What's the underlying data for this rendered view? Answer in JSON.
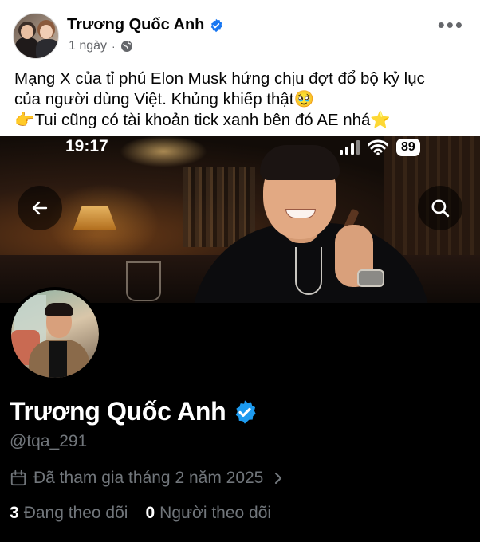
{
  "post": {
    "author": "Trương Quốc Anh",
    "time": "1 ngày",
    "separator": "·",
    "more": "•••",
    "text_lines": [
      "Mạng X của tỉ phú Elon Musk hứng chịu đợt đổ bộ kỷ lục",
      "của người dùng Việt. Khủng khiếp thật🥹",
      "👉Tui cũng có tài khoản tick xanh bên đó AE nhá⭐"
    ]
  },
  "screenshot": {
    "status": {
      "time": "19:17",
      "battery": "89"
    },
    "profile": {
      "name": "Trương Quốc Anh",
      "handle": "@tqa_291",
      "joined": "Đã tham gia tháng 2 năm 2025",
      "following_count": "3",
      "following_label": "Đang theo dõi",
      "followers_count": "0",
      "followers_label": "Người theo dõi"
    }
  },
  "colors": {
    "facebook_verified": "#1877f2",
    "x_verified": "#1d9bf0",
    "x_muted_text": "#71767b",
    "x_background": "#000000"
  },
  "icons": [
    "globe-icon",
    "more-icon",
    "verified-badge-icon",
    "back-arrow-icon",
    "search-icon",
    "calendar-icon",
    "chevron-right-icon",
    "signal-icon",
    "wifi-icon"
  ]
}
